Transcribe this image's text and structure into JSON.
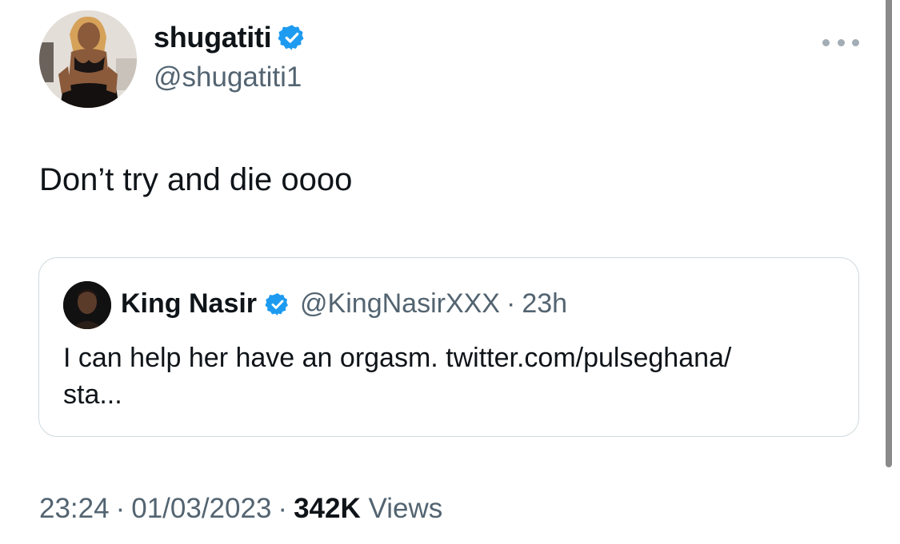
{
  "tweet": {
    "author": {
      "display_name": "shugatiti",
      "handle": "@shugatiti1",
      "verified": true
    },
    "more_icon": "more-horizontal-icon",
    "text": "Don’t try and die oooo",
    "quoted_tweet": {
      "author": {
        "display_name": "King Nasir",
        "handle": "@KingNasirXXX",
        "verified": true
      },
      "separator": "·",
      "time_ago": "23h",
      "text": "I can help her have an orgasm. twitter.com/pulseghana/\nsta..."
    },
    "meta": {
      "time": "23:24",
      "date": "01/03/2023",
      "separator": "·",
      "views_count": "342K",
      "views_label": "Views"
    }
  },
  "colors": {
    "verified_blue": "#1d9bf0",
    "secondary_text": "#536471",
    "primary_text": "#0f1419",
    "border": "#cfd9de"
  }
}
